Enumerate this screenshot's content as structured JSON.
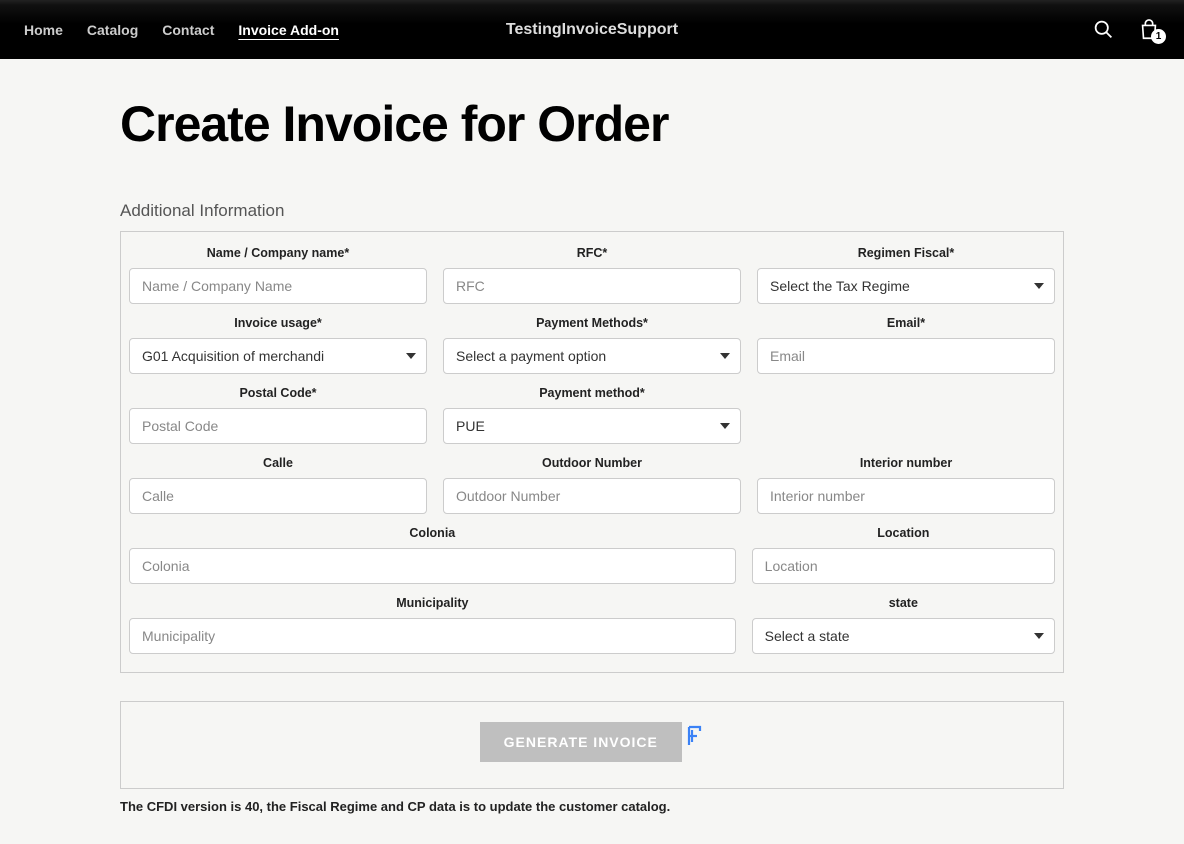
{
  "nav": {
    "items": [
      {
        "label": "Home",
        "active": false
      },
      {
        "label": "Catalog",
        "active": false
      },
      {
        "label": "Contact",
        "active": false
      },
      {
        "label": "Invoice Add-on",
        "active": true
      }
    ],
    "brand": "TestingInvoiceSupport",
    "cart_count": "1"
  },
  "page": {
    "title": "Create Invoice for Order",
    "section_heading": "Additional Information"
  },
  "fields": {
    "name": {
      "label": "Name / Company name*",
      "placeholder": "Name / Company Name"
    },
    "rfc": {
      "label": "RFC*",
      "placeholder": "RFC"
    },
    "regimen": {
      "label": "Regimen Fiscal*",
      "selected": "Select the Tax Regime"
    },
    "usage": {
      "label": "Invoice usage*",
      "selected": "G01 Acquisition of merchandi"
    },
    "payment_methods": {
      "label": "Payment Methods*",
      "selected": "Select a payment option"
    },
    "email": {
      "label": "Email*",
      "placeholder": "Email"
    },
    "postal": {
      "label": "Postal Code*",
      "placeholder": "Postal Code"
    },
    "payment_method": {
      "label": "Payment method*",
      "selected": "PUE"
    },
    "calle": {
      "label": "Calle",
      "placeholder": "Calle"
    },
    "outdoor": {
      "label": "Outdoor Number",
      "placeholder": "Outdoor Number"
    },
    "interior": {
      "label": "Interior number",
      "placeholder": "Interior number"
    },
    "colonia": {
      "label": "Colonia",
      "placeholder": "Colonia"
    },
    "location": {
      "label": "Location",
      "placeholder": "Location"
    },
    "municipality": {
      "label": "Municipality",
      "placeholder": "Municipality"
    },
    "state": {
      "label": "state",
      "selected": "Select a state"
    }
  },
  "actions": {
    "generate_label": "GENERATE INVOICE"
  },
  "footnote": "The CFDI version is 40, the Fiscal Regime and CP data is to update the customer catalog."
}
